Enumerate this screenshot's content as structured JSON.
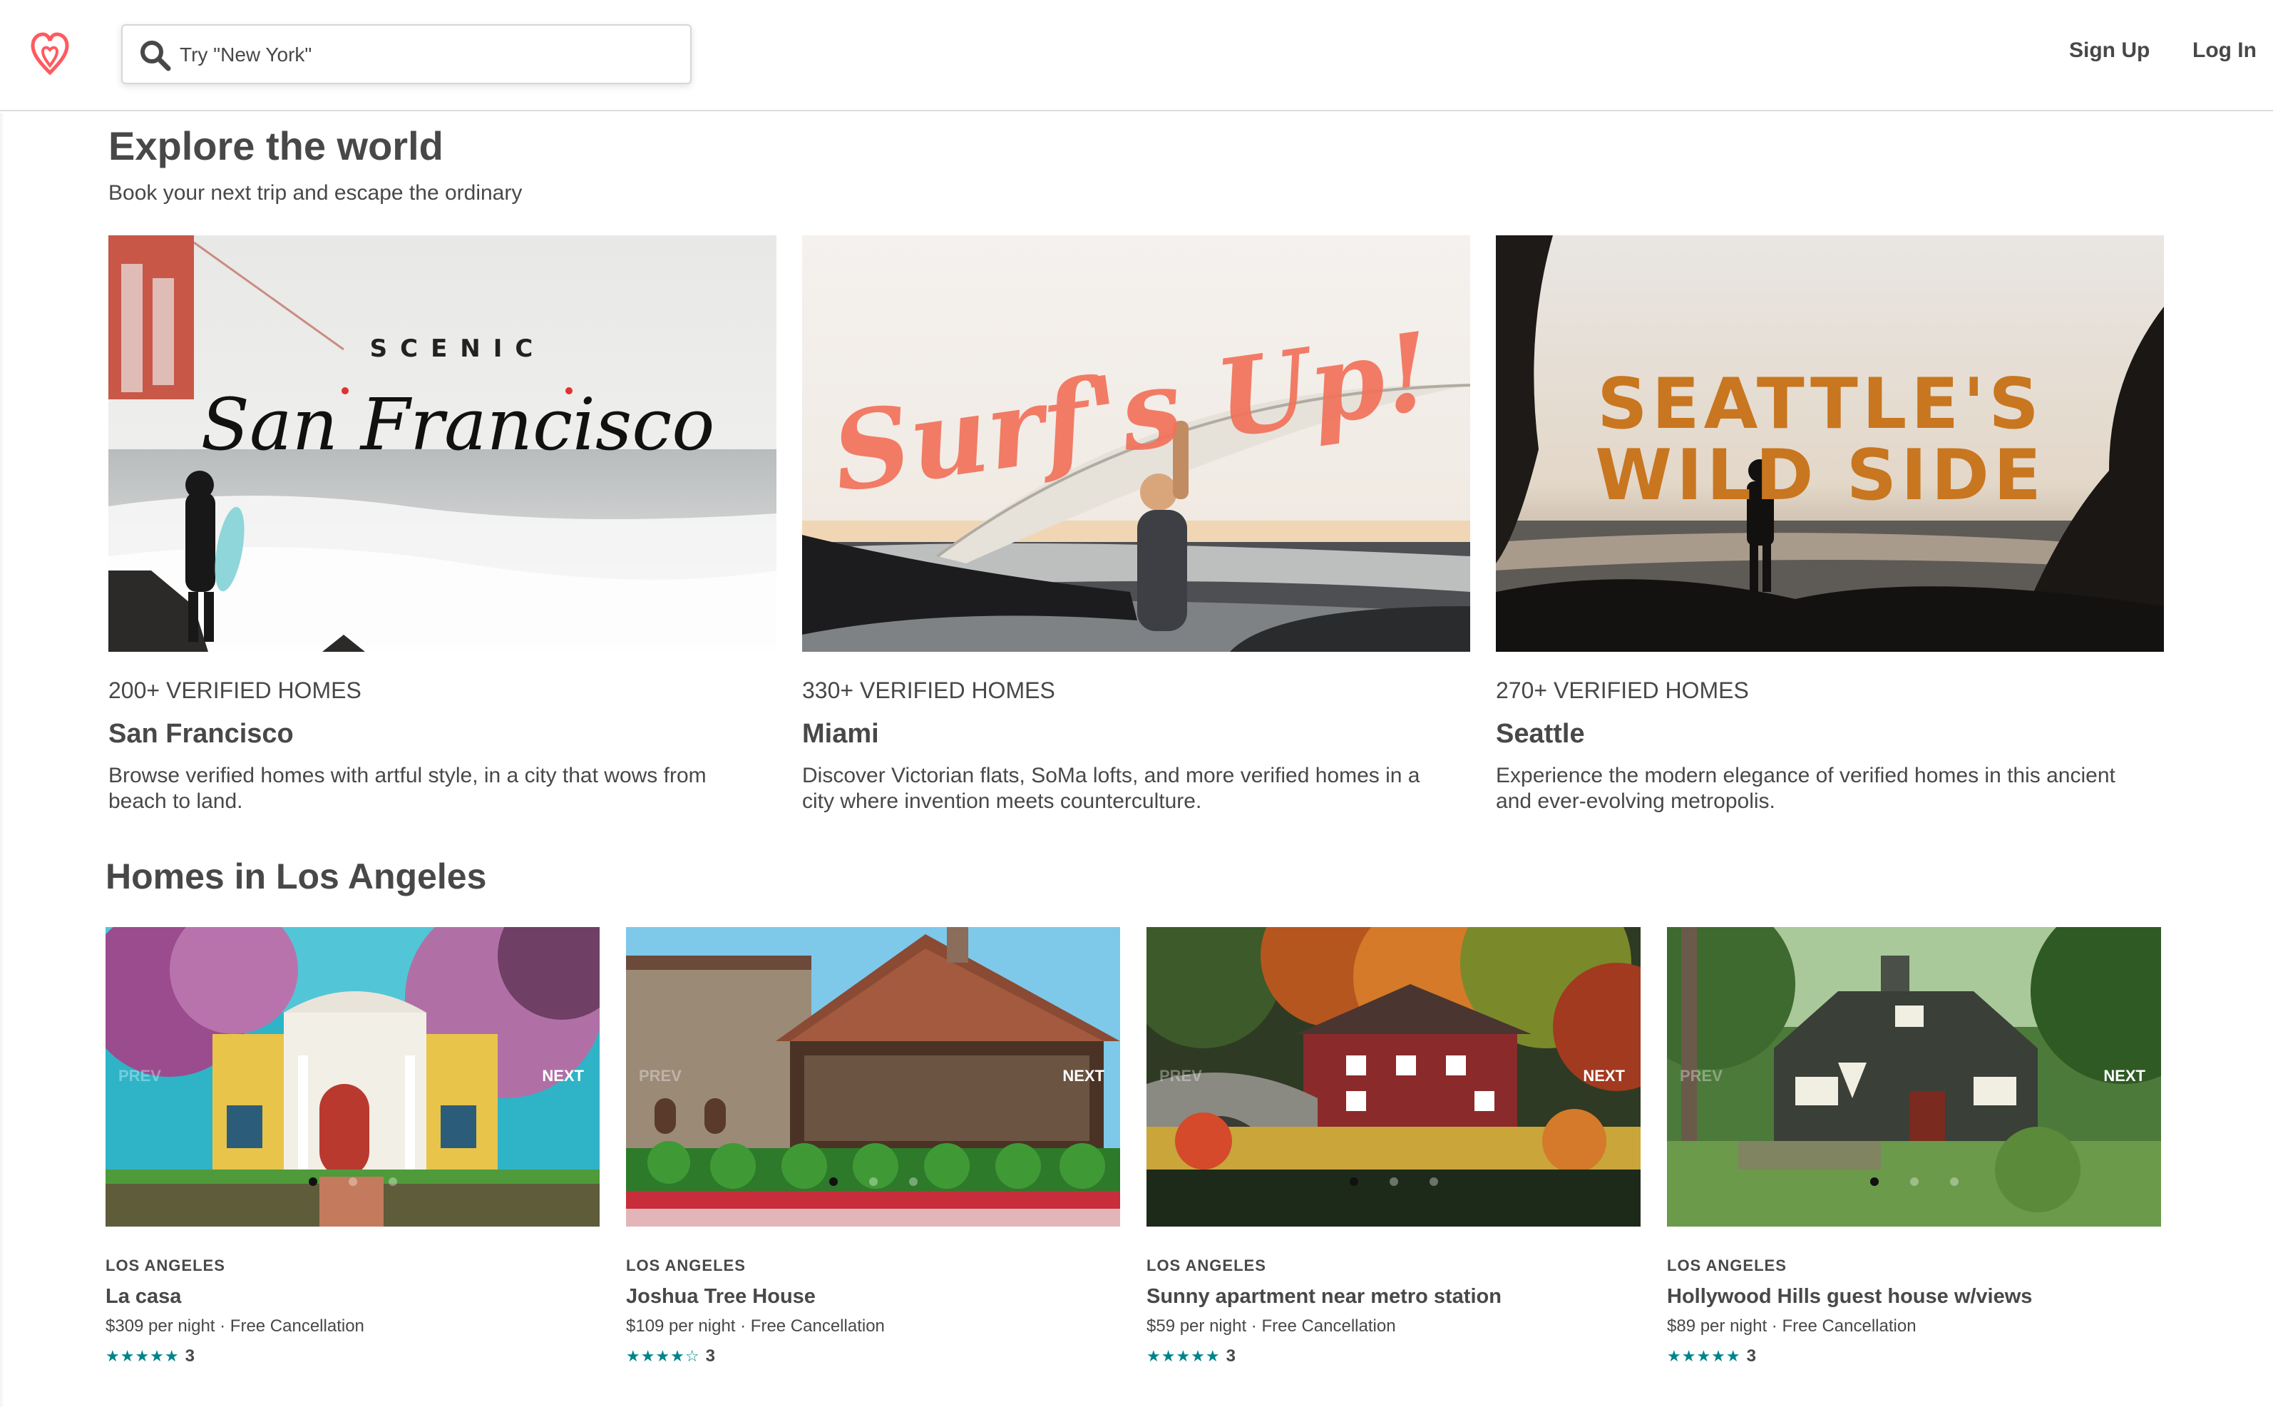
{
  "brand": {
    "color": "#ff5a5f",
    "logo_icon": "airbnb-belo-icon"
  },
  "header": {
    "search_placeholder": "Try \"New York\"",
    "search_icon": "search-icon",
    "signup_label": "Sign Up",
    "login_label": "Log In"
  },
  "explore": {
    "title": "Explore the world",
    "subtitle": "Book your next trip and escape the ordinary",
    "cities": [
      {
        "count_label": "200+ VERIFIED HOMES",
        "name": "San Francisco",
        "description": "Browse verified homes with artful style, in a city that wows from beach to land.",
        "image_text_top": "SCENIC",
        "image_text_main": "San Francisco"
      },
      {
        "count_label": "330+ VERIFIED HOMES",
        "name": "Miami",
        "description": "Discover Victorian flats, SoMa lofts, and more verified homes in a city where invention meets counterculture.",
        "image_text_main": "Surf's Up!"
      },
      {
        "count_label": "270+ VERIFIED HOMES",
        "name": "Seattle",
        "description": "Experience the modern elegance of verified homes in this ancient and ever-evolving metropolis.",
        "image_text_line1": "SEATTLE'S",
        "image_text_line2": "WILD SIDE"
      }
    ]
  },
  "homes": {
    "title": "Homes in Los Angeles",
    "prev_label": "PREV",
    "next_label": "NEXT",
    "rating_icon": "star-icon",
    "listings": [
      {
        "location": "LOS ANGELES",
        "title": "La casa",
        "price_line": "$309 per night · Free Cancellation",
        "stars": "★★★★★",
        "rating_value": 4.5,
        "reviews": "3"
      },
      {
        "location": "LOS ANGELES",
        "title": "Joshua Tree House",
        "price_line": "$109 per night · Free Cancellation",
        "stars": "★★★★☆",
        "rating_value": 4,
        "reviews": "3"
      },
      {
        "location": "LOS ANGELES",
        "title": "Sunny apartment near metro station",
        "price_line": "$59 per night · Free Cancellation",
        "stars": "★★★★★",
        "rating_value": 4.5,
        "reviews": "3"
      },
      {
        "location": "LOS ANGELES",
        "title": "Hollywood Hills guest house w/views",
        "price_line": "$89 per night · Free Cancellation",
        "stars": "★★★★★",
        "rating_value": 4.5,
        "reviews": "3"
      }
    ]
  }
}
